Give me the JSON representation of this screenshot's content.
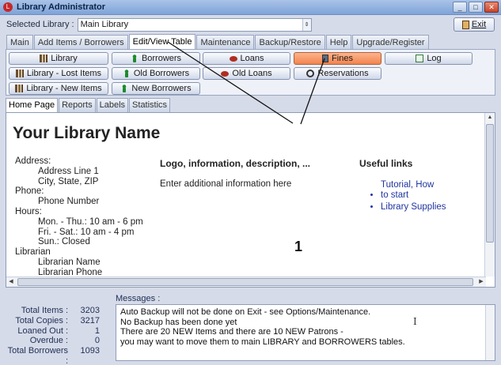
{
  "window": {
    "title": "Library Administrator",
    "app_icon": "app-logo-icon",
    "controls": [
      "_",
      "□",
      "✕"
    ]
  },
  "library": {
    "label": "Selected Library :",
    "selected": "Main Library"
  },
  "exit_label": "Exit",
  "tabs": [
    "Main",
    "Add Items / Borrowers",
    "Edit/View Table",
    "Maintenance",
    "Backup/Restore",
    "Help",
    "Upgrade/Register"
  ],
  "toolbar": {
    "library": "Library",
    "borrowers": "Borrowers",
    "loans": "Loans",
    "fines": "Fines",
    "log": "Log",
    "library_lost": "Library - Lost Items",
    "old_borrowers": "Old Borrowers",
    "old_loans": "Old Loans",
    "reservations": "Reservations",
    "library_new": "Library - New Items",
    "new_borrowers": "New Borrowers"
  },
  "subtabs": [
    "Home Page",
    "Reports",
    "Labels",
    "Statistics"
  ],
  "home": {
    "library_name": "Your Library Name",
    "address_label": "Address:",
    "address_line1": "Address Line 1",
    "address_line2": "City, State, ZIP",
    "phone_label": "Phone:",
    "phone_value": "Phone Number",
    "hours_label": "Hours:",
    "hours_1": "Mon. - Thu.: 10 am - 6 pm",
    "hours_2": "Fri. - Sat.: 10 am - 4 pm",
    "hours_3": "Sun.: Closed",
    "librarian_label": "Librarian",
    "librarian_name": "Librarian Name",
    "librarian_phone": "Librarian Phone",
    "logo_heading": "Logo, information, description, ...",
    "logo_text": "Enter additional information here",
    "links_heading": "Useful links",
    "link_1": "Tutorial, How to start",
    "link_2": "Library Supplies"
  },
  "callout": "1",
  "stats": {
    "total_items_label": "Total Items :",
    "total_items": "3203",
    "total_copies_label": "Total Copies :",
    "total_copies": "3217",
    "loaned_out_label": "Loaned Out :",
    "loaned_out": "1",
    "overdue_label": "Overdue :",
    "overdue": "0",
    "total_borrowers_label": "Total Borrowers :",
    "total_borrowers": "1093"
  },
  "messages": {
    "label": "Messages :",
    "line1": "Auto Backup will not be done on Exit - see Options/Maintenance.",
    "line2": "No Backup has been done yet",
    "line3": "There are 20 NEW Items and there are 10 NEW Patrons -",
    "line4": "you may want to move them to main LIBRARY and BORROWERS tables."
  },
  "colors": {
    "active_button": "#f2834e",
    "titlebar": "#7fa3d8",
    "link": "#2035a0"
  }
}
